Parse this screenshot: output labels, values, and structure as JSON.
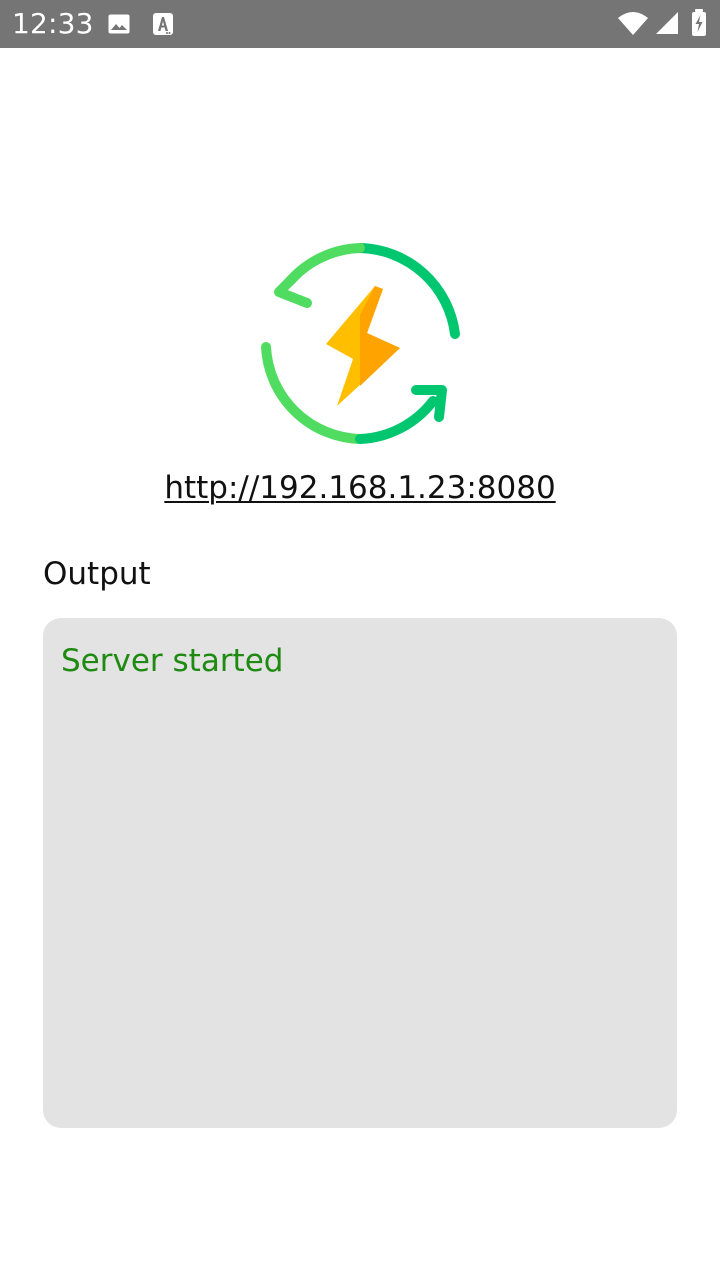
{
  "status_bar": {
    "time": "12:33",
    "icons": {
      "gallery": "gallery-icon",
      "text": "text-a-icon",
      "wifi": "wifi-icon",
      "signal": "signal-icon",
      "battery": "battery-icon"
    },
    "background_color": "#757575"
  },
  "app": {
    "logo_icon": "sync-lightning-icon",
    "server_url": "http://192.168.1.23:8080"
  },
  "output": {
    "label": "Output",
    "log": "Server started",
    "panel_color": "#e3e3e3",
    "text_color": "#1e8a11"
  }
}
